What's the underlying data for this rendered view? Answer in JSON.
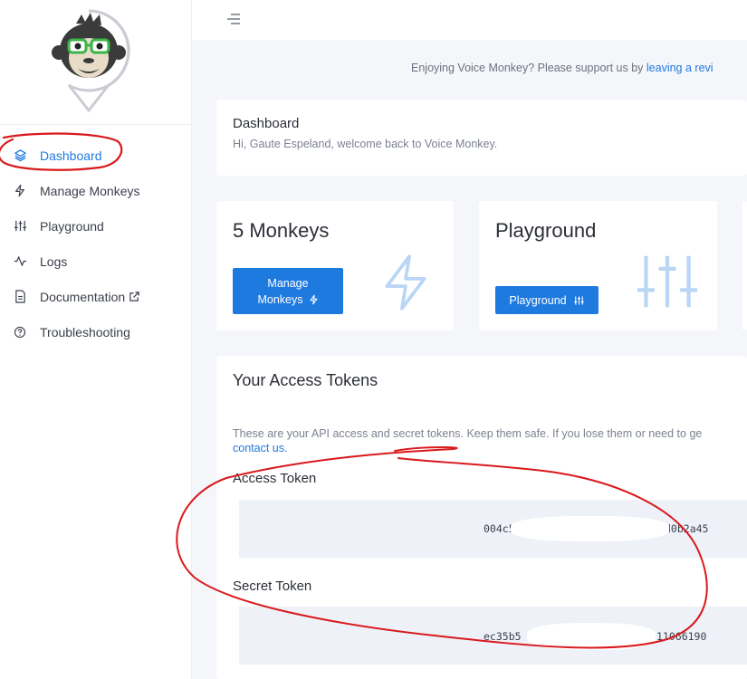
{
  "sidebar": {
    "logo_icon": "monkey-with-glasses-logo",
    "items": [
      {
        "label": "Dashboard",
        "icon": "layers-icon",
        "active": true
      },
      {
        "label": "Manage Monkeys",
        "icon": "lightning-icon"
      },
      {
        "label": "Playground",
        "icon": "sliders-icon"
      },
      {
        "label": "Logs",
        "icon": "activity-icon"
      },
      {
        "label": "Documentation",
        "icon": "document-icon",
        "external_icon": "external-link-icon"
      },
      {
        "label": "Troubleshooting",
        "icon": "help-circle-icon"
      }
    ]
  },
  "topbar": {
    "menu_icon": "hamburger-icon"
  },
  "promo": {
    "text": "Enjoying Voice Monkey? Please support us by ",
    "link": "leaving a revi"
  },
  "dashboard_card": {
    "title": "Dashboard",
    "subtitle": "Hi, Gaute Espeland, welcome back to Voice Monkey."
  },
  "monkeys_card": {
    "title": "5 Monkeys",
    "button_line1": "Manage",
    "button_line2": "Monkeys",
    "icon": "lightning-icon"
  },
  "playground_card": {
    "title": "Playground",
    "button_label": "Playground",
    "icon": "sliders-icon"
  },
  "tokens_card": {
    "title": "Your Access Tokens",
    "description": "These are your API access and secret tokens. Keep them safe. If you lose them or need to ge",
    "contact_link": "contact us.",
    "access_label": "Access Token",
    "access_value_start": "004c5",
    "access_value_end": "d0b2a45",
    "secret_label": "Secret Token",
    "secret_value_start": "ec35b5",
    "secret_value_end": "11066190"
  },
  "colors": {
    "accent": "#1f7ae0",
    "annotation": "#d9191c",
    "background": "#f4f6fa"
  }
}
